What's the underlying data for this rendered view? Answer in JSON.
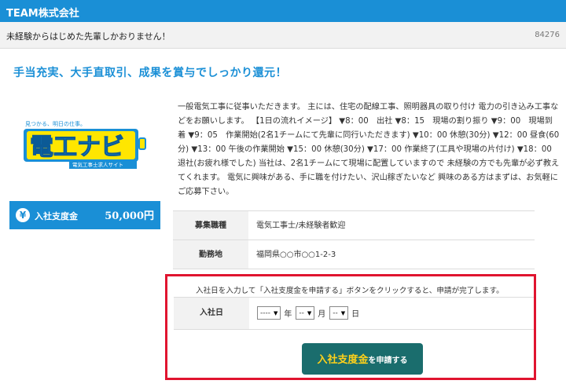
{
  "header": {
    "company": "TEAM株式会社"
  },
  "subbar": {
    "message": "未経験からはじめた先輩しかおりません！",
    "id": "84276"
  },
  "headline": "手当充実、大手直取引、成果を賞与でしっかり還元！",
  "logo": {
    "tagline": "見つかる、明日の仕事。",
    "main": "電工ナビ",
    "subtitle": "電気工事士求人サイト"
  },
  "bonus": {
    "label": "入社支度金",
    "amount": "50,000円"
  },
  "description": "一般電気工事に従事いただきます。 主には、住宅の配線工事、照明器具の取り付け 電力の引き込み工事などをお願いします。 【1日の流れイメージ】 ▼8：00　出社 ▼8：15　現場の割り振り ▼9：00　現場到着 ▼9：05　作業開始(2名1チームにて先輩に同行いただきます) ▼10：00 休憩(30分) ▼12：00 昼食(60分) ▼13：00 午後の作業開始 ▼15：00 休憩(30分) ▼17：00 作業終了(工具や現場の片付け) ▼18：00 退社(お疲れ様でした) 当社は、2名1チームにて現場に配置していますので 未経験の方でも先輩が必ず教えてくれます。 電気に興味がある、手に職を付けたい、沢山稼ぎたいなど 興味のある方はまずは、お気軽にご応募下さい。",
  "table": {
    "rows": [
      {
        "label": "募集職種",
        "value": "電気工事士/未経験者歓迎"
      },
      {
        "label": "勤務地",
        "value": "福岡県○○市○○1-2-3"
      }
    ]
  },
  "apply": {
    "note": "入社日を入力して「入社支度金を申請する」ボタンをクリックすると、申請が完了します。",
    "date_label": "入社日",
    "year_value": "----",
    "year_unit": "年",
    "month_value": "--",
    "month_unit": "月",
    "day_value": "--",
    "day_unit": "日",
    "button_main": "入社支度金",
    "button_rest": "を申請する"
  },
  "colors": {
    "primary": "#1a8fd6",
    "button": "#1a6d6d",
    "highlight": "#e0142f",
    "accent_yellow": "#ffd11a"
  }
}
